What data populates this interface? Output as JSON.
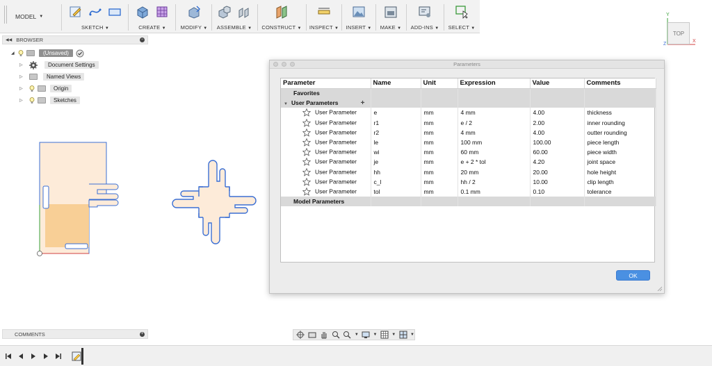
{
  "toolbar": {
    "workspace_label": "MODEL",
    "groups": [
      {
        "label": "SKETCH",
        "icons": [
          "create-sketch-icon",
          "spline-icon",
          "rectangle-icon"
        ]
      },
      {
        "label": "CREATE",
        "icons": [
          "extrude-box-icon",
          "form-cage-icon"
        ]
      },
      {
        "label": "MODIFY",
        "icons": [
          "press-pull-icon"
        ]
      },
      {
        "label": "ASSEMBLE",
        "icons": [
          "new-component-icon",
          "joint-icon"
        ]
      },
      {
        "label": "CONSTRUCT",
        "icons": [
          "offset-plane-icon"
        ]
      },
      {
        "label": "INSPECT",
        "icons": [
          "measure-icon"
        ]
      },
      {
        "label": "INSERT",
        "icons": [
          "insert-image-icon"
        ]
      },
      {
        "label": "MAKE",
        "icons": [
          "3d-print-icon"
        ]
      },
      {
        "label": "ADD-INS",
        "icons": [
          "scripts-icon"
        ]
      },
      {
        "label": "SELECT",
        "icons": [
          "select-icon"
        ]
      }
    ]
  },
  "browser": {
    "title": "BROWSER",
    "root": "(Unsaved)",
    "items": [
      {
        "label": "Document Settings"
      },
      {
        "label": "Named Views"
      },
      {
        "label": "Origin"
      },
      {
        "label": "Sketches"
      }
    ]
  },
  "viewcube": {
    "face": "TOP",
    "axis_x": "X",
    "axis_y": "Y",
    "axis_z": "Z"
  },
  "dialog": {
    "title": "Parameters",
    "columns": [
      "Parameter",
      "Name",
      "Unit",
      "Expression",
      "Value",
      "Comments"
    ],
    "favorites_label": "Favorites",
    "user_parameters_label": "User Parameters",
    "model_parameters_label": "Model Parameters",
    "rows": [
      {
        "type": "User Parameter",
        "name": "e",
        "unit": "mm",
        "expression": "4 mm",
        "value": "4.00",
        "comment": "thickness"
      },
      {
        "type": "User Parameter",
        "name": "r1",
        "unit": "mm",
        "expression": "e / 2",
        "value": "2.00",
        "comment": "inner rounding"
      },
      {
        "type": "User Parameter",
        "name": "r2",
        "unit": "mm",
        "expression": "4 mm",
        "value": "4.00",
        "comment": "outter rounding"
      },
      {
        "type": "User Parameter",
        "name": "le",
        "unit": "mm",
        "expression": "100 mm",
        "value": "100.00",
        "comment": "piece length"
      },
      {
        "type": "User Parameter",
        "name": "wi",
        "unit": "mm",
        "expression": "60 mm",
        "value": "60.00",
        "comment": "piece width"
      },
      {
        "type": "User Parameter",
        "name": "je",
        "unit": "mm",
        "expression": "e + 2 * tol",
        "value": "4.20",
        "comment": "joint space"
      },
      {
        "type": "User Parameter",
        "name": "hh",
        "unit": "mm",
        "expression": "20 mm",
        "value": "20.00",
        "comment": "hole height"
      },
      {
        "type": "User Parameter",
        "name": "c_l",
        "unit": "mm",
        "expression": "hh / 2",
        "value": "10.00",
        "comment": "clip length"
      },
      {
        "type": "User Parameter",
        "name": "tol",
        "unit": "mm",
        "expression": "0.1 mm",
        "value": "0.10",
        "comment": "tolerance"
      }
    ],
    "ok_label": "OK"
  },
  "comments": {
    "title": "COMMENTS"
  },
  "colors": {
    "accent": "#4a90e2",
    "sketch_line": "#3b6fd4",
    "sketch_fill": "#fde9d6",
    "profile_fill": "#f9cf95"
  }
}
